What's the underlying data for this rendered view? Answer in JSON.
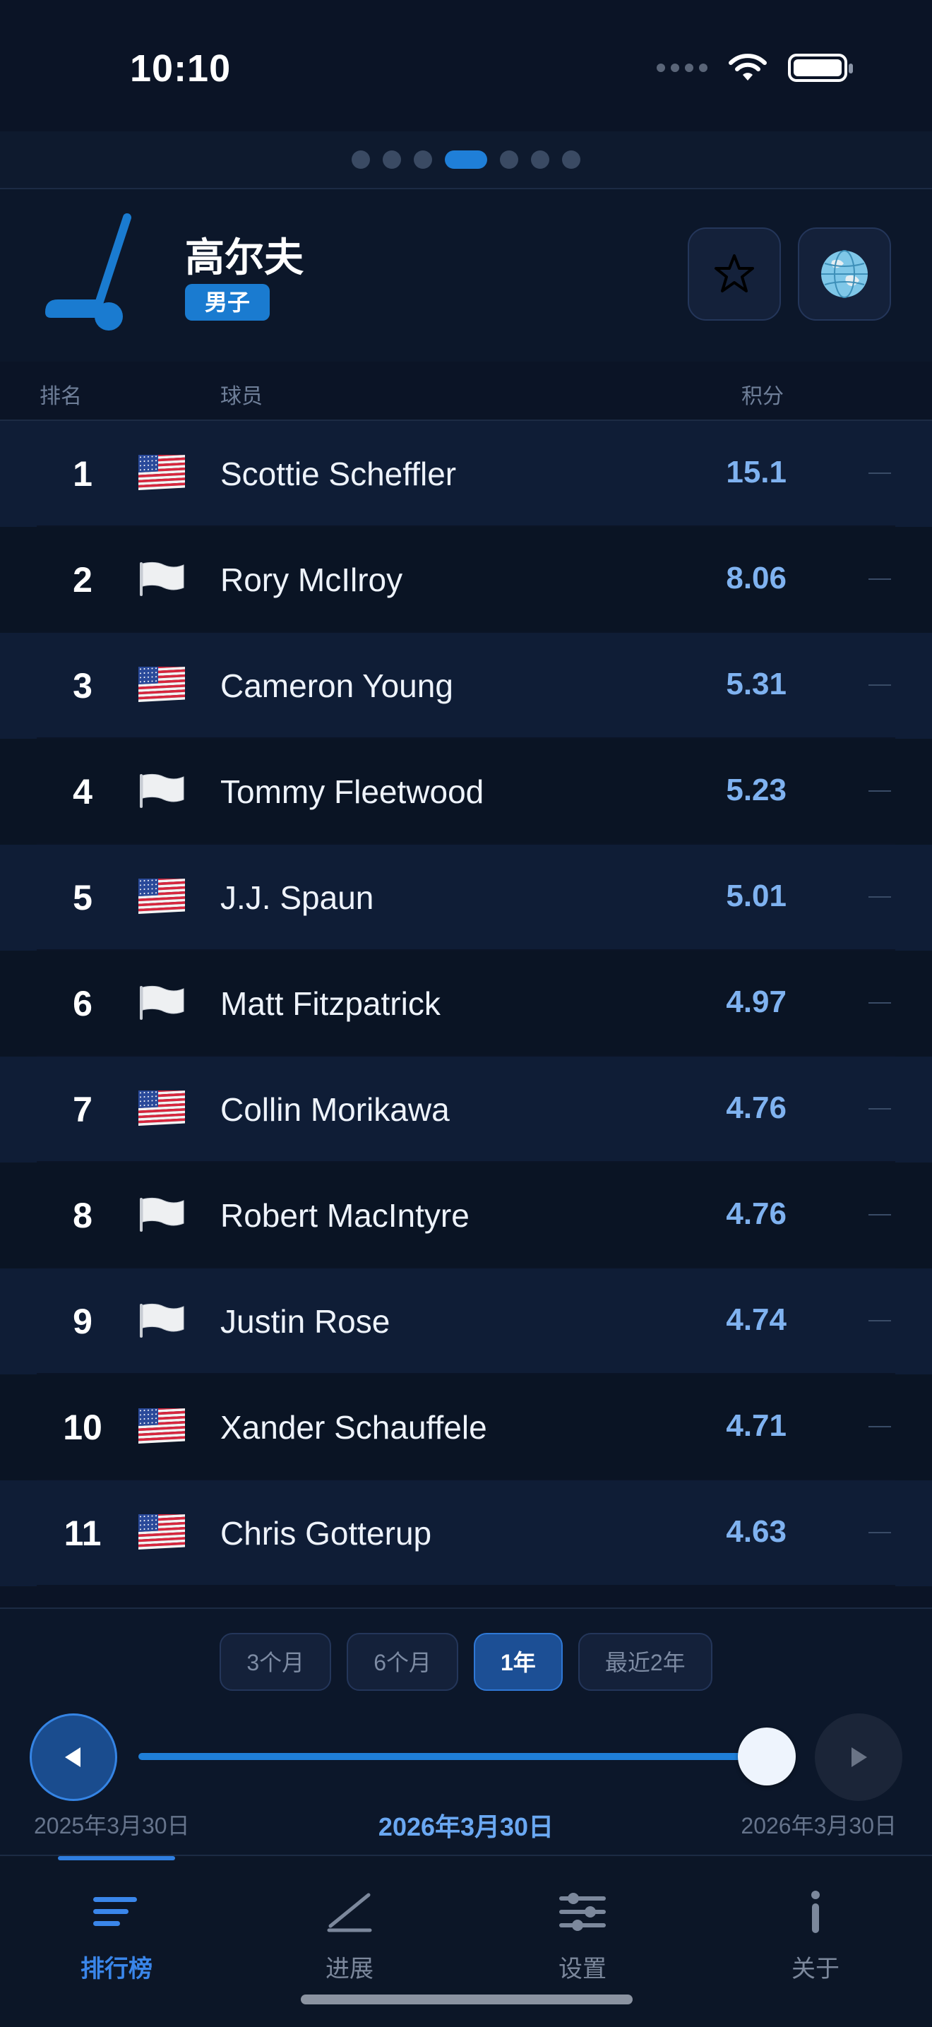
{
  "status_bar": {
    "time": "10:10"
  },
  "pager": {
    "count": 7,
    "active_index": 3
  },
  "header": {
    "title": "高尔夫",
    "badge": "男子",
    "icon": "golf-club-icon"
  },
  "table_header": {
    "rank": "排名",
    "player": "球员",
    "points": "积分"
  },
  "rows": [
    {
      "rank": "1",
      "flag": "us",
      "name": "Scottie Scheffler",
      "points": "15.1",
      "trend": "—"
    },
    {
      "rank": "2",
      "flag": "white",
      "name": "Rory McIlroy",
      "points": "8.06",
      "trend": "—"
    },
    {
      "rank": "3",
      "flag": "us",
      "name": "Cameron Young",
      "points": "5.31",
      "trend": "—"
    },
    {
      "rank": "4",
      "flag": "white",
      "name": "Tommy Fleetwood",
      "points": "5.23",
      "trend": "—"
    },
    {
      "rank": "5",
      "flag": "us",
      "name": "J.J. Spaun",
      "points": "5.01",
      "trend": "—"
    },
    {
      "rank": "6",
      "flag": "white",
      "name": "Matt Fitzpatrick",
      "points": "4.97",
      "trend": "—"
    },
    {
      "rank": "7",
      "flag": "us",
      "name": "Collin Morikawa",
      "points": "4.76",
      "trend": "—"
    },
    {
      "rank": "8",
      "flag": "white",
      "name": "Robert MacIntyre",
      "points": "4.76",
      "trend": "—"
    },
    {
      "rank": "9",
      "flag": "white",
      "name": "Justin Rose",
      "points": "4.74",
      "trend": "—"
    },
    {
      "rank": "10",
      "flag": "us",
      "name": "Xander Schauffele",
      "points": "4.71",
      "trend": "—"
    },
    {
      "rank": "11",
      "flag": "us",
      "name": "Chris Gotterup",
      "points": "4.63",
      "trend": "—"
    }
  ],
  "time_ranges": [
    {
      "label": "3个月",
      "active": false
    },
    {
      "label": "6个月",
      "active": false
    },
    {
      "label": "1年",
      "active": true
    },
    {
      "label": "最近2年",
      "active": false
    }
  ],
  "timeline": {
    "start_date": "2025年3月30日",
    "current_date": "2026年3月30日",
    "end_date": "2026年3月30日",
    "progress": 1.0
  },
  "tabs": [
    {
      "label": "排行榜",
      "icon": "list-icon",
      "active": true
    },
    {
      "label": "进展",
      "icon": "trend-line-icon",
      "active": false
    },
    {
      "label": "设置",
      "icon": "sliders-icon",
      "active": false
    },
    {
      "label": "关于",
      "icon": "info-icon",
      "active": false
    }
  ],
  "colors": {
    "accent": "#1f7fd8",
    "points": "#7fb2f0",
    "background": "#0b1426"
  }
}
